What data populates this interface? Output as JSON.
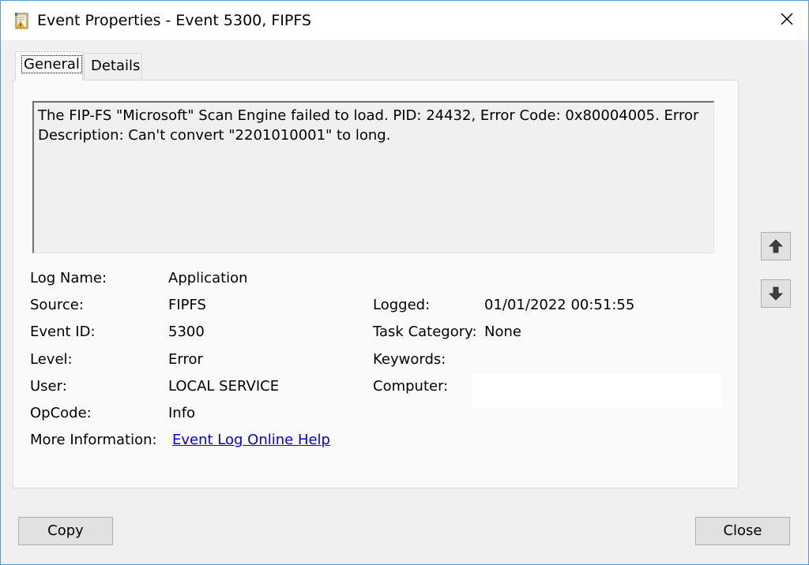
{
  "window": {
    "title": "Event Properties - Event 5300, FIPFS"
  },
  "icons": {
    "app": "event-log-icon",
    "close": "close-icon",
    "up": "arrow-up-icon",
    "down": "arrow-down-icon"
  },
  "tabs": [
    {
      "label": "General",
      "active": true
    },
    {
      "label": "Details",
      "active": false
    }
  ],
  "description": "The FIP-FS \"Microsoft\" Scan Engine failed to load. PID: 24432, Error Code: 0x80004005. Error Description: Can't convert \"2201010001\" to long.",
  "fields": {
    "log_name": {
      "label": "Log Name:",
      "value": "Application"
    },
    "source": {
      "label": "Source:",
      "value": "FIPFS"
    },
    "event_id": {
      "label": "Event ID:",
      "value": "5300"
    },
    "level": {
      "label": "Level:",
      "value": "Error"
    },
    "user": {
      "label": "User:",
      "value": "LOCAL SERVICE"
    },
    "opcode": {
      "label": "OpCode:",
      "value": "Info"
    },
    "more_info": {
      "label": "More Information:",
      "value": "Event Log Online Help"
    },
    "logged": {
      "label": "Logged:",
      "value": "01/01/2022 00:51:55"
    },
    "task_category": {
      "label": "Task Category:",
      "value": "None"
    },
    "keywords": {
      "label": "Keywords:",
      "value": ""
    },
    "computer": {
      "label": "Computer:",
      "value": ""
    }
  },
  "buttons": {
    "copy": "Copy",
    "close": "Close"
  },
  "colors": {
    "window_border": "#5b9bd5",
    "link": "#0000ee",
    "dialog_bg": "#f0f0f0"
  }
}
